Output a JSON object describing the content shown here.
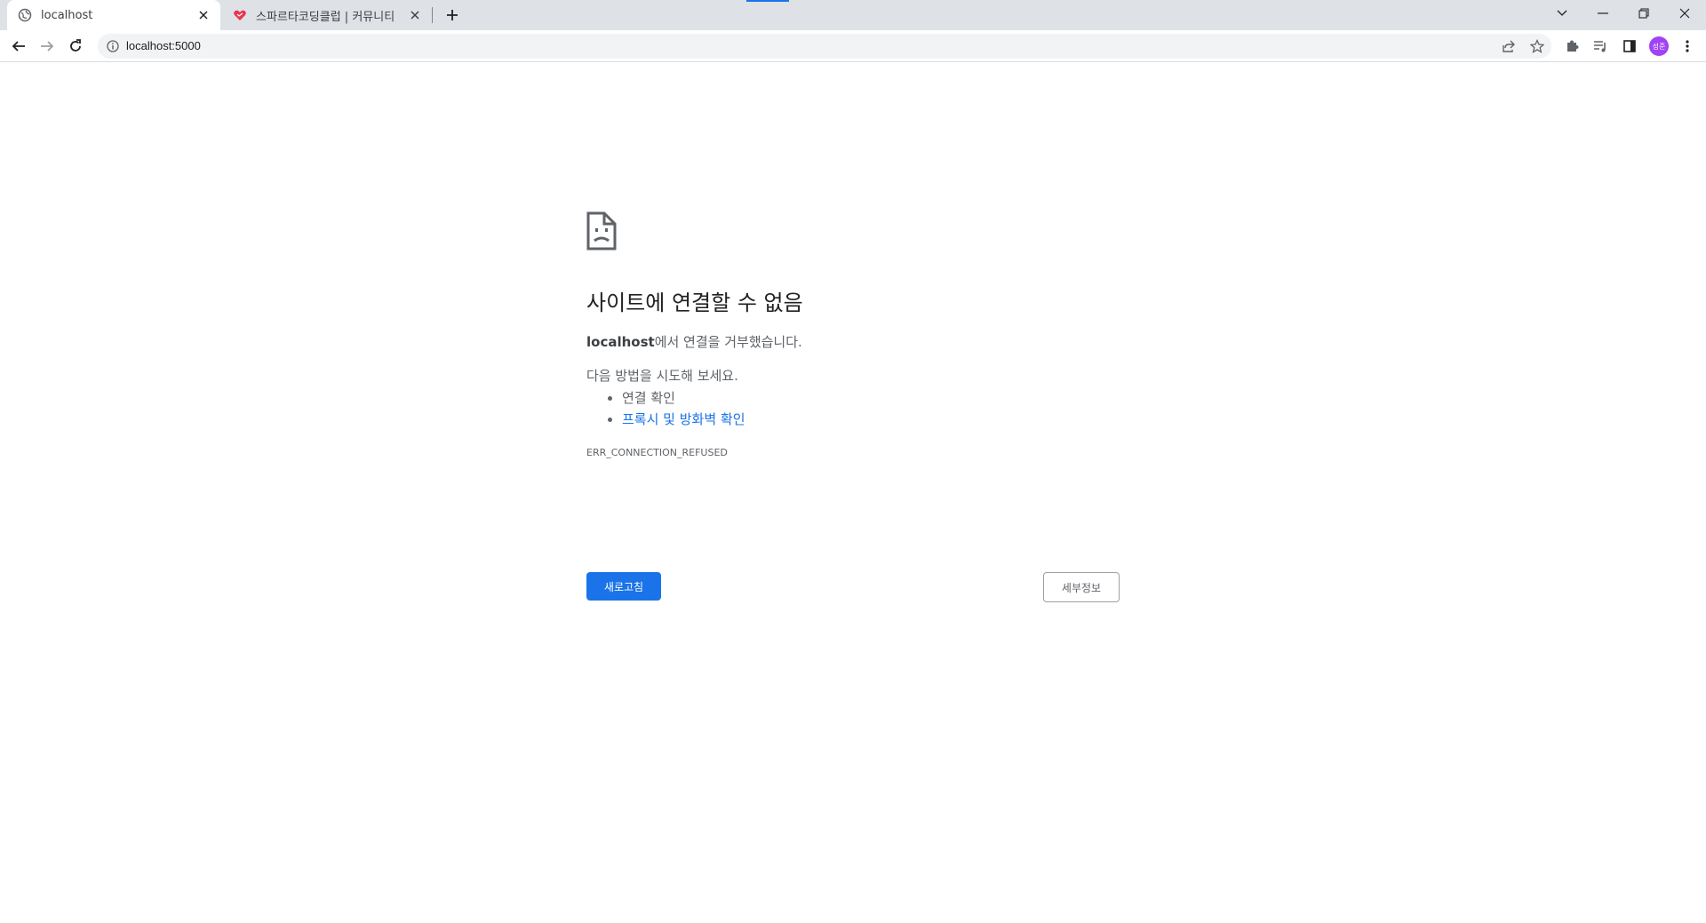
{
  "tabs": [
    {
      "title": "localhost",
      "icon": "globe-icon",
      "active": true
    },
    {
      "title": "스파르타코딩클럽 | 커뮤니티",
      "icon": "sparta-heart-icon",
      "active": false
    }
  ],
  "address_bar": {
    "url": "localhost:5000"
  },
  "profile": {
    "initials": "성준"
  },
  "error": {
    "heading": "사이트에 연결할 수 없음",
    "host": "localhost",
    "summary_rest": "에서 연결을 거부했습니다.",
    "suggestions_title": "다음 방법을 시도해 보세요.",
    "suggestions": [
      {
        "text": "연결 확인",
        "link": false
      },
      {
        "text": "프록시 및 방화벽 확인",
        "link": true
      }
    ],
    "code": "ERR_CONNECTION_REFUSED",
    "reload_button": "새로고침",
    "details_button": "세부정보"
  },
  "colors": {
    "accent": "#1a73e8",
    "profile_bg": "#a142f4",
    "tab_strip": "#dee1e6"
  }
}
